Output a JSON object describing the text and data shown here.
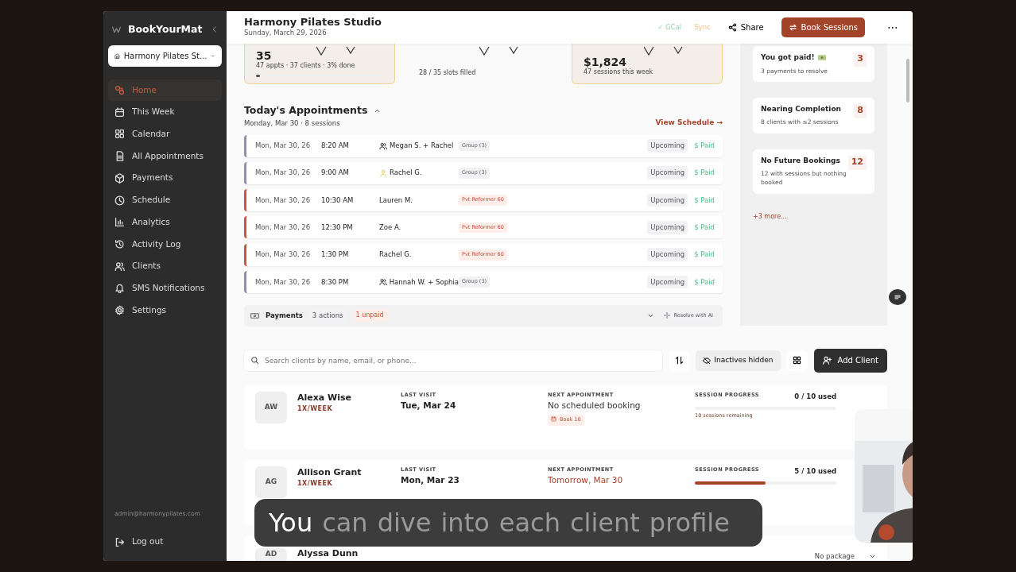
{
  "sidebar": {
    "brand": "BookYourMat",
    "studio": "Harmony Pilates St...",
    "items": [
      {
        "label": "Home",
        "selected": true
      },
      {
        "label": "This Week",
        "selected": false
      },
      {
        "label": "Calendar",
        "selected": false
      },
      {
        "label": "All Appointments",
        "selected": false
      },
      {
        "label": "Payments",
        "selected": false
      },
      {
        "label": "Schedule",
        "selected": false
      },
      {
        "label": "Analytics",
        "selected": false
      },
      {
        "label": "Activity Log",
        "selected": false
      },
      {
        "label": "Clients",
        "selected": false
      },
      {
        "label": "SMS Notifications",
        "selected": false
      },
      {
        "label": "Settings",
        "selected": false
      }
    ],
    "account": "admin@harmonypilates.com",
    "logout": "Log out"
  },
  "header": {
    "title": "Harmony Pilates Studio",
    "date": "Sunday, March 29, 2026",
    "gcal": "✓ GCal",
    "sync": "Sync",
    "share": "Share",
    "book": "Book Sessions",
    "more": "⋯"
  },
  "stat_cards": [
    {
      "value": "35",
      "caption": "47 appts · 37 clients · 3% done",
      "highlighted": true,
      "level": 0.03
    },
    {
      "caption": "28 / 35 slots filled",
      "highlighted": false
    },
    {
      "value": "$1,824",
      "caption": "47 sessions this week",
      "highlighted": true
    }
  ],
  "appointments": {
    "title": "Today's Appointments",
    "subtitle": "Monday, Mar 30 · 8 sessions",
    "expanded": true,
    "link": "View Schedule →",
    "rows": [
      {
        "date": "Mon, Mar 30, 26",
        "time": "8:20 AM",
        "group_icon": true,
        "client": "Megan S. + Rachel",
        "kind": "group",
        "service": "Group (3)",
        "status": "Upcoming",
        "payment": "$ Paid"
      },
      {
        "date": "Mon, Mar 30, 26",
        "time": "9:00 AM",
        "person_icon": true,
        "client": "Rachel G.",
        "kind": "group",
        "service": "Group (3)",
        "status": "Upcoming",
        "payment": "$ Paid"
      },
      {
        "date": "Mon, Mar 30, 26",
        "time": "10:30 AM",
        "client": "Lauren M.",
        "kind": "private",
        "service": "Pvt Reformer 60",
        "status": "Upcoming",
        "payment": "$ Paid"
      },
      {
        "date": "Mon, Mar 30, 26",
        "time": "12:30 PM",
        "client": "Zoe A.",
        "kind": "private",
        "service": "Pvt Reformer 60",
        "status": "Upcoming",
        "payment": "$ Paid"
      },
      {
        "date": "Mon, Mar 30, 26",
        "time": "1:30 PM",
        "client": "Rachel G.",
        "kind": "private",
        "service": "Pvt Reformer 60",
        "status": "Upcoming",
        "payment": "$ Paid"
      },
      {
        "date": "Mon, Mar 30, 26",
        "time": "8:30 PM",
        "group_icon": true,
        "client": "Hannah W. + Sophia",
        "kind": "group",
        "service": "Group (3)",
        "status": "Upcoming",
        "payment": "$ Paid"
      }
    ]
  },
  "payments_bar": {
    "label": "Payments",
    "actions": "3 actions",
    "unpaid": "1 unpaid",
    "resolve": "Resolve with AI"
  },
  "alerts": {
    "items": [
      {
        "title": "You got paid!",
        "money_icon": true,
        "detail": "3 payments to resolve",
        "count": "3"
      },
      {
        "title": "Nearing Completion",
        "detail": "8 clients with ≤2 sessions",
        "count": "8"
      },
      {
        "title": "No Future Bookings",
        "detail": "12 with sessions but nothing booked",
        "count": "12"
      }
    ],
    "more": "+3 more..."
  },
  "clients": {
    "search": {
      "placeholder": "Search clients by name, email, or phone..."
    },
    "inactives": "Inactives hidden",
    "add": "Add Client",
    "rows": [
      {
        "kind": "full",
        "initials": "AW",
        "name": "Alexa Wise",
        "frequency": "1X/WEEK",
        "last_label": "LAST VISIT",
        "last": "Tue, Mar 24",
        "next_label": "NEXT APPOINTMENT",
        "next": "No scheduled booking",
        "booked": false,
        "book_tag": "Book 10",
        "progress_label": "SESSION PROGRESS",
        "used": "0 / 10 used",
        "level": 0,
        "remaining": "10 sessions remaining"
      },
      {
        "kind": "full",
        "initials": "AG",
        "name": "Allison Grant",
        "frequency": "1X/WEEK",
        "last_label": "LAST VISIT",
        "last": "Mon, Mar 23",
        "next_label": "NEXT APPOINTMENT",
        "next": "Tomorrow, Mar 30",
        "booked": true,
        "progress_label": "SESSION PROGRESS",
        "used": "5 / 10 used",
        "level": 0.5
      },
      {
        "kind": "collapsed",
        "initials": "AD",
        "name": "Alyssa Dunn",
        "package": "No package"
      }
    ]
  },
  "video_caption": {
    "words": [
      {
        "text": "You",
        "spoken": true
      },
      {
        "text": "can",
        "spoken": false
      },
      {
        "text": "dive",
        "spoken": false
      },
      {
        "text": "into",
        "spoken": false
      },
      {
        "text": "each",
        "spoken": false
      },
      {
        "text": "client",
        "spoken": false
      },
      {
        "text": "profile",
        "spoken": false
      }
    ]
  }
}
